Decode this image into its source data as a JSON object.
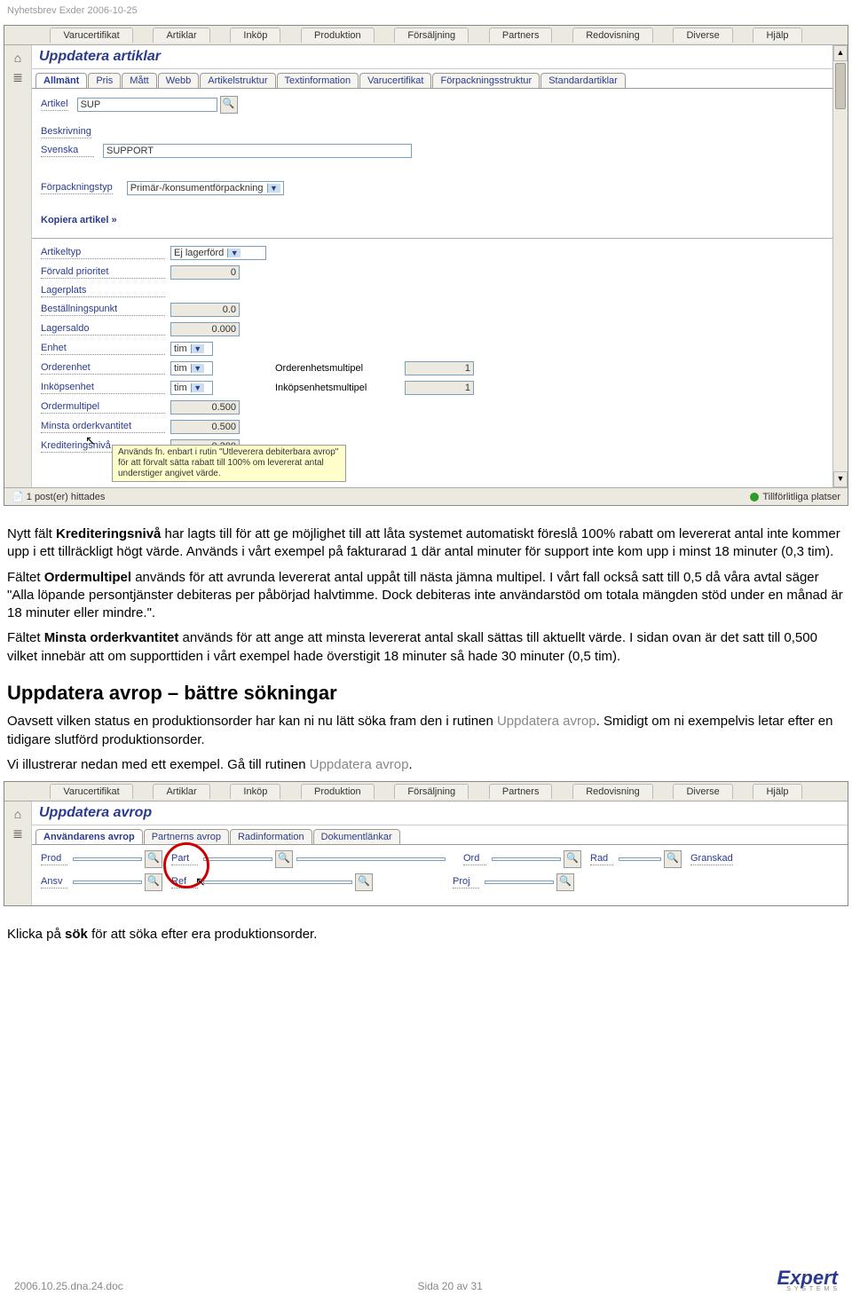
{
  "header": {
    "title": "Nyhetsbrev Exder 2006-10-25"
  },
  "menubar": [
    "Varucertifikat",
    "Artiklar",
    "Inköp",
    "Produktion",
    "Försäljning",
    "Partners",
    "Redovisning",
    "Diverse",
    "Hjälp"
  ],
  "shot1": {
    "title": "Uppdatera artiklar",
    "tabs": [
      "Allmänt",
      "Pris",
      "Mått",
      "Webb",
      "Artikelstruktur",
      "Textinformation",
      "Varucertifikat",
      "Förpackningsstruktur",
      "Standardartiklar"
    ],
    "activeTab": 0,
    "fields": {
      "artikel_lbl": "Artikel",
      "artikel_val": "SUP",
      "beskrivning_lbl": "Beskrivning",
      "svenska_lbl": "Svenska",
      "svenska_val": "SUPPORT",
      "forpackningstyp_lbl": "Förpackningstyp",
      "forpackningstyp_val": "Primär-/konsumentförpackning",
      "copy_link": "Kopiera artikel »",
      "artikeltyp_lbl": "Artikeltyp",
      "artikeltyp_val": "Ej lagerförd",
      "forvald_lbl": "Förvald prioritet",
      "forvald_val": "0",
      "lagerplats_lbl": "Lagerplats",
      "bestall_lbl": "Beställningspunkt",
      "bestall_val": "0.0",
      "lagersaldo_lbl": "Lagersaldo",
      "lagersaldo_val": "0.000",
      "enhet_lbl": "Enhet",
      "enhet_val": "tim",
      "orderenhet_lbl": "Orderenhet",
      "orderenhet_val": "tim",
      "orderenhetsmultipel_lbl": "Orderenhetsmultipel",
      "orderenhetsmultipel_val": "1",
      "inkopsenhet_lbl": "Inköpsenhet",
      "inkopsenhet_val": "tim",
      "inkopsenhetsmultipel_lbl": "Inköpsenhetsmultipel",
      "inkopsenhetsmultipel_val": "1",
      "ordermultipel_lbl": "Ordermultipel",
      "ordermultipel_val": "0.500",
      "minsta_lbl": "Minsta orderkvantitet",
      "minsta_val": "0.500",
      "kred_lbl": "Krediteringsnivå",
      "kred_val": "0.300"
    },
    "tooltip": "Används fn. enbart i rutin \"Utleverera debiterbara avrop\" för att förvalt sätta rabatt till 100% om levererat antal understiger angivet värde.",
    "status_left": "1 post(er) hittades",
    "status_right": "Tillförlitliga platser"
  },
  "article": {
    "p1a": "Nytt fält ",
    "p1b": "Krediteringsnivå",
    "p1c": " har lagts till för att ge möjlighet till att låta systemet automatiskt föreslå 100% rabatt om levererat antal inte kommer upp i ett tillräckligt högt värde. Används i vårt exempel på fakturarad 1 där antal minuter för support inte kom upp i minst 18 minuter (0,3 tim).",
    "p2a": "Fältet ",
    "p2b": "Ordermultipel",
    "p2c": " används för att avrunda levererat antal uppåt till nästa jämna multipel. I vårt fall också satt till 0,5 då våra avtal säger \"Alla löpande persontjänster debiteras per påbörjad halvtimme. Dock debiteras inte användarstöd om totala mängden stöd under en månad är 18 minuter eller mindre.\".",
    "p3a": "Fältet ",
    "p3b": "Minsta orderkvantitet",
    "p3c": " används för att ange att minsta levererat antal skall sättas till aktuellt värde. I sidan ovan är det satt till 0,500 vilket innebär att om supporttiden i vårt exempel hade överstigit 18 minuter så hade 30 minuter (0,5 tim).",
    "h2": "Uppdatera avrop – bättre sökningar",
    "p4a": "Oavsett vilken status en produktionsorder har kan ni nu lätt söka fram den i rutinen ",
    "p4b": "Uppdatera avrop",
    "p4c": ". Smidigt om ni exempelvis letar efter en tidigare slutförd produktionsorder.",
    "p5a": "Vi illustrerar nedan med ett exempel. Gå till rutinen ",
    "p5b": "Uppdatera avrop",
    "p5c": ".",
    "p6a": "Klicka på ",
    "p6b": "sök",
    "p6c": " för att söka efter era produktionsorder."
  },
  "shot2": {
    "title": "Uppdatera avrop",
    "tabs": [
      "Användarens avrop",
      "Partnerns avrop",
      "Radinformation",
      "Dokumentlänkar"
    ],
    "activeTab": 0,
    "labels": {
      "prod": "Prod",
      "part": "Part",
      "ord": "Ord",
      "rad": "Rad",
      "granskad": "Granskad",
      "ansv": "Ansv",
      "ref": "Ref",
      "proj": "Proj"
    }
  },
  "footer": {
    "left": "2006.10.25.dna.24.doc",
    "center": "Sida 20 av 31",
    "logo_main": "Expert",
    "logo_sub": "S Y S T E M S"
  }
}
